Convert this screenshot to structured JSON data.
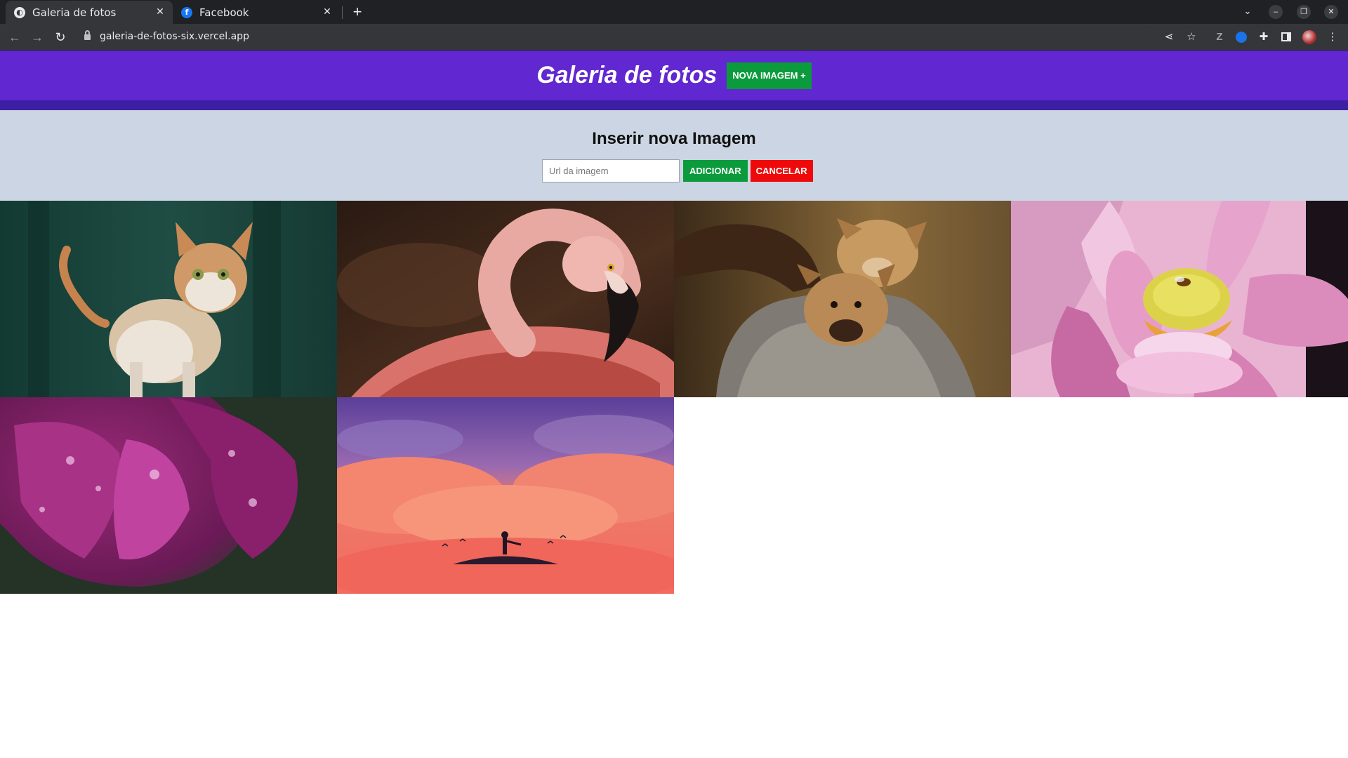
{
  "browser": {
    "tabs": [
      {
        "title": "Galeria de fotos",
        "active": true
      },
      {
        "title": "Facebook",
        "active": false
      }
    ],
    "new_tab": "+",
    "url": "galeria-de-fotos-six.vercel.app"
  },
  "header": {
    "title": "Galeria de fotos",
    "new_image_button": "NOVA IMAGEM +"
  },
  "form": {
    "heading": "Inserir nova Imagem",
    "url_placeholder": "Url da imagem",
    "add_button": "ADICIONAR",
    "cancel_button": "CANCELAR"
  },
  "colors": {
    "header_bg": "#6127d1",
    "header_bar": "#3c1fa3",
    "form_bg": "#cbd5e3",
    "add_green": "#0b9b3d",
    "cancel_red": "#ee0a0a"
  },
  "gallery": {
    "images": [
      {
        "subject": "cat"
      },
      {
        "subject": "flamingo"
      },
      {
        "subject": "puppies"
      },
      {
        "subject": "lotus-with-bee"
      },
      {
        "subject": "purple-petals-with-drops"
      },
      {
        "subject": "person-on-cloud-hill"
      }
    ]
  }
}
